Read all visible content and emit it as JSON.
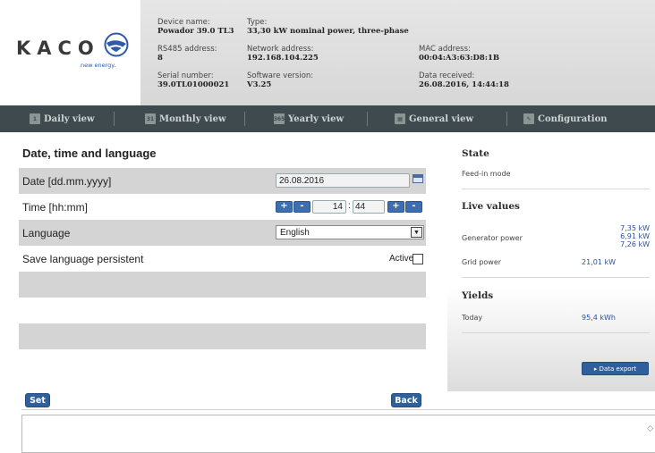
{
  "logo": {
    "brand": "KACO",
    "tagline": "new energy."
  },
  "device": {
    "name_label": "Device name:",
    "name": "Powador 39.0 TL3",
    "type_label": "Type:",
    "type": "33,30 kW nominal power, three-phase",
    "rs485_label": "RS485 address:",
    "rs485": "8",
    "network_label": "Network address:",
    "network": "192.168.104.225",
    "mac_label": "MAC address:",
    "mac": "00:04:A3:63:D8:1B",
    "serial_label": "Serial number:",
    "serial": "39.0TL01000021",
    "software_label": "Software version:",
    "software": "V3.25",
    "received_label": "Data received:",
    "received": "26.08.2016, 14:44:18"
  },
  "nav": {
    "daily": "Daily view",
    "daily_icon": "1",
    "monthly": "Monthly view",
    "monthly_icon": "31",
    "yearly": "Yearly view",
    "yearly_icon": "365",
    "general": "General view",
    "config": "Configuration"
  },
  "form": {
    "title": "Date, time and language",
    "date_label": "Date [dd.mm.yyyy]",
    "date_value": "26.08.2016",
    "time_label": "Time [hh:mm]",
    "hour": "14",
    "minute": "44",
    "colon": ":",
    "plus": "+",
    "minus": "-",
    "language_label": "Language",
    "language_value": "English",
    "save_label": "Save language persistent",
    "active_label": "Active",
    "active_checked": false
  },
  "buttons": {
    "set": "Set",
    "back": "Back"
  },
  "side": {
    "state_title": "State",
    "state_value": "Feed-in mode",
    "live_title": "Live values",
    "generator_label": "Generator power",
    "generator_values": [
      "7,35 kW",
      "6,91 kW",
      "7,26 kW"
    ],
    "grid_label": "Grid power",
    "grid_value": "21,01 kW",
    "yields_title": "Yields",
    "today_label": "Today",
    "today_value": "95,4 kWh",
    "export_label": "▸ Data export"
  },
  "colors": {
    "nav_bg": "#3e4a4d",
    "accent_blue": "#2f5f9c",
    "row_shade": "#d4d4d4"
  }
}
